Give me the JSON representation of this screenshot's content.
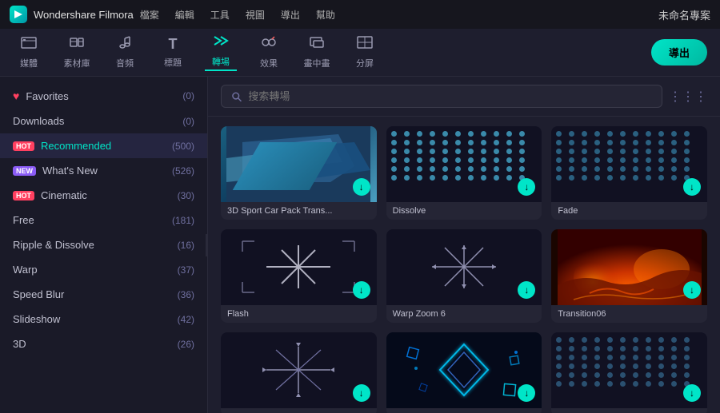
{
  "titleBar": {
    "appName": "Wondershare Filmora",
    "logoText": "F",
    "menu": [
      "檔案",
      "編輯",
      "工具",
      "視圖",
      "導出",
      "幫助"
    ],
    "projectName": "未命名專案"
  },
  "toolbar": {
    "items": [
      {
        "id": "media",
        "icon": "🗂",
        "label": "媒體"
      },
      {
        "id": "materials",
        "icon": "🖼",
        "label": "素材庫"
      },
      {
        "id": "audio",
        "icon": "🎵",
        "label": "音頻"
      },
      {
        "id": "title",
        "icon": "T",
        "label": "標題"
      },
      {
        "id": "transition",
        "icon": "✦",
        "label": "轉場",
        "active": true
      },
      {
        "id": "effects",
        "icon": "✨",
        "label": "效果"
      },
      {
        "id": "overlay",
        "icon": "🎬",
        "label": "畫中畫"
      },
      {
        "id": "split",
        "icon": "⊞",
        "label": "分屏"
      }
    ],
    "exportLabel": "導出"
  },
  "sidebar": {
    "items": [
      {
        "id": "favorites",
        "icon": "heart",
        "label": "Favorites",
        "count": "(0)",
        "badge": null
      },
      {
        "id": "downloads",
        "icon": null,
        "label": "Downloads",
        "count": "(0)",
        "badge": null
      },
      {
        "id": "recommended",
        "icon": null,
        "label": "Recommended",
        "count": "(500)",
        "badge": "HOT",
        "selected": true
      },
      {
        "id": "whats-new",
        "icon": null,
        "label": "What's New",
        "count": "(526)",
        "badge": "New"
      },
      {
        "id": "cinematic",
        "icon": null,
        "label": "Cinematic",
        "count": "(30)",
        "badge": "HOT"
      },
      {
        "id": "free",
        "icon": null,
        "label": "Free",
        "count": "(181)",
        "badge": null
      },
      {
        "id": "ripple",
        "icon": null,
        "label": "Ripple & Dissolve",
        "count": "(16)",
        "badge": null
      },
      {
        "id": "warp",
        "icon": null,
        "label": "Warp",
        "count": "(37)",
        "badge": null
      },
      {
        "id": "speed-blur",
        "icon": null,
        "label": "Speed Blur",
        "count": "(36)",
        "badge": null
      },
      {
        "id": "slideshow",
        "icon": null,
        "label": "Slideshow",
        "count": "(42)",
        "badge": null
      },
      {
        "id": "3d",
        "icon": null,
        "label": "3D",
        "count": "(26)",
        "badge": null
      }
    ]
  },
  "search": {
    "placeholder": "搜索轉場"
  },
  "grid": {
    "cards": [
      {
        "id": "car-pack",
        "label": "3D Sport Car Pack Trans...",
        "type": "car"
      },
      {
        "id": "dissolve",
        "label": "Dissolve",
        "type": "dissolve"
      },
      {
        "id": "fade",
        "label": "Fade",
        "type": "fade"
      },
      {
        "id": "flash",
        "label": "Flash",
        "type": "flash"
      },
      {
        "id": "warp-zoom",
        "label": "Warp Zoom 6",
        "type": "warp"
      },
      {
        "id": "transition06",
        "label": "Transition06",
        "type": "fire"
      },
      {
        "id": "arrows",
        "label": "",
        "type": "arrows"
      },
      {
        "id": "blue-diamond",
        "label": "",
        "type": "blue-diamond"
      },
      {
        "id": "dots3",
        "label": "",
        "type": "dots2"
      }
    ]
  }
}
